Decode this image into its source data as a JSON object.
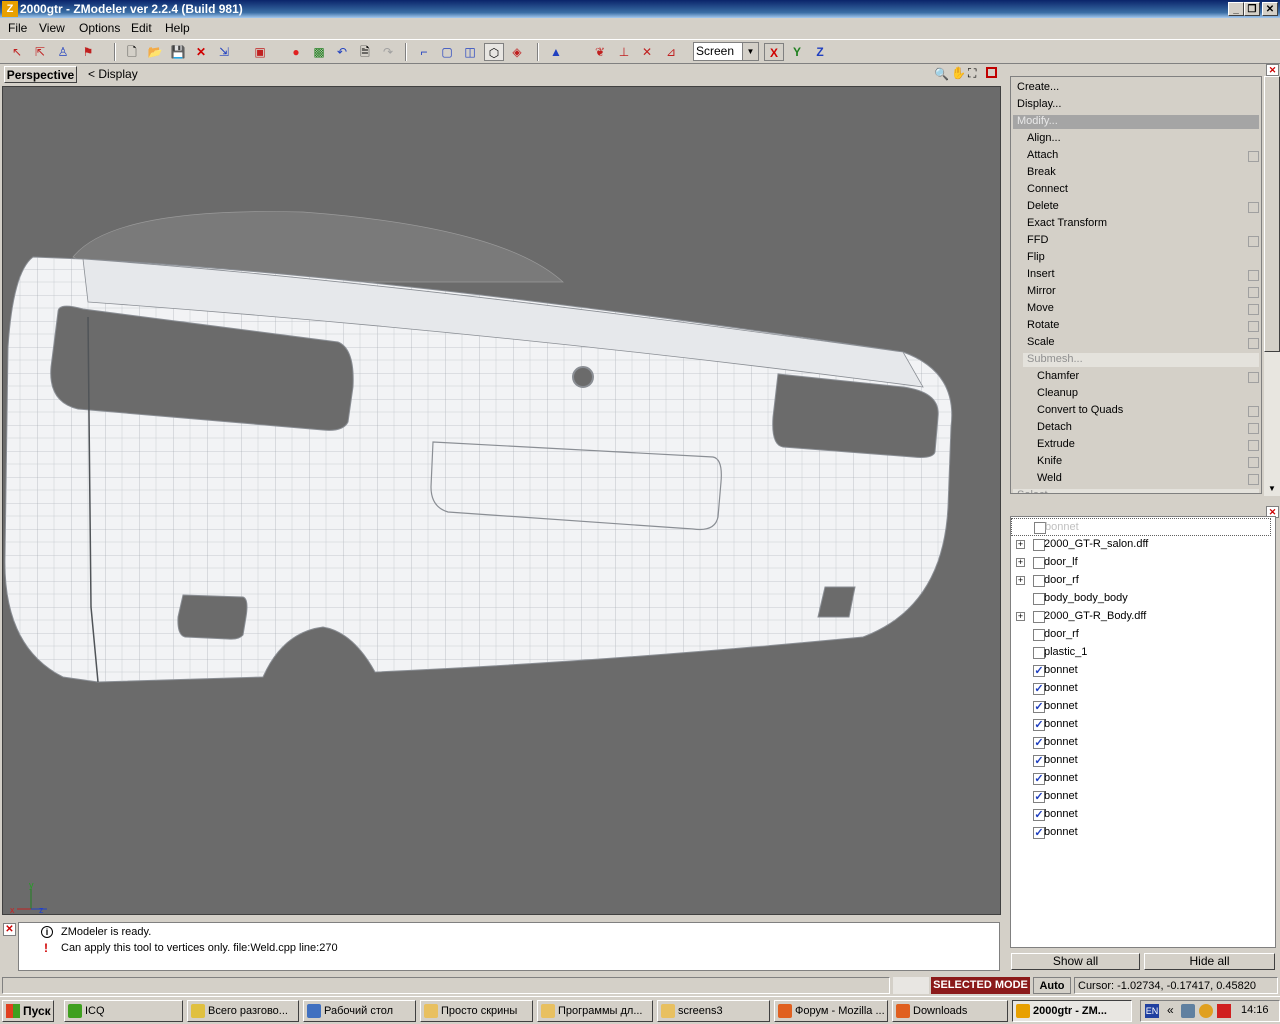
{
  "window": {
    "title": "2000gtr - ZModeler ver 2.2.4 (Build 981)",
    "app_icon": "Z"
  },
  "menubar": {
    "items": [
      "File",
      "View",
      "Options",
      "Edit",
      "Help"
    ]
  },
  "toolbar": {
    "coord_mode": "Screen",
    "axis_x": "X",
    "axis_y": "Y",
    "axis_z": "Z"
  },
  "viewport": {
    "tab": "Perspective",
    "display_link": "<  Display",
    "axis_x": "x",
    "axis_y": "y",
    "axis_z": "z"
  },
  "modify_panel": {
    "items": [
      {
        "label": "Create...",
        "level": 0,
        "checkbox": false,
        "state": "normal"
      },
      {
        "label": "Display...",
        "level": 0,
        "checkbox": false,
        "state": "normal"
      },
      {
        "label": "Modify...",
        "level": 0,
        "checkbox": false,
        "state": "selected"
      },
      {
        "label": "Align...",
        "level": 1,
        "checkbox": false,
        "state": "normal"
      },
      {
        "label": "Attach",
        "level": 1,
        "checkbox": true,
        "state": "normal"
      },
      {
        "label": "Break",
        "level": 1,
        "checkbox": false,
        "state": "normal"
      },
      {
        "label": "Connect",
        "level": 1,
        "checkbox": false,
        "state": "normal"
      },
      {
        "label": "Delete",
        "level": 1,
        "checkbox": true,
        "state": "normal"
      },
      {
        "label": "Exact Transform",
        "level": 1,
        "checkbox": false,
        "state": "normal"
      },
      {
        "label": "FFD",
        "level": 1,
        "checkbox": true,
        "state": "normal"
      },
      {
        "label": "Flip",
        "level": 1,
        "checkbox": false,
        "state": "normal"
      },
      {
        "label": "Insert",
        "level": 1,
        "checkbox": true,
        "state": "normal"
      },
      {
        "label": "Mirror",
        "level": 1,
        "checkbox": true,
        "state": "normal"
      },
      {
        "label": "Move",
        "level": 1,
        "checkbox": true,
        "state": "normal"
      },
      {
        "label": "Rotate",
        "level": 1,
        "checkbox": true,
        "state": "normal"
      },
      {
        "label": "Scale",
        "level": 1,
        "checkbox": true,
        "state": "normal"
      },
      {
        "label": "Submesh...",
        "level": 1,
        "checkbox": false,
        "state": "group"
      },
      {
        "label": "Chamfer",
        "level": 2,
        "checkbox": true,
        "state": "normal"
      },
      {
        "label": "Cleanup",
        "level": 2,
        "checkbox": false,
        "state": "normal"
      },
      {
        "label": "Convert to Quads",
        "level": 2,
        "checkbox": true,
        "state": "normal"
      },
      {
        "label": "Detach",
        "level": 2,
        "checkbox": true,
        "state": "normal"
      },
      {
        "label": "Extrude",
        "level": 2,
        "checkbox": true,
        "state": "normal"
      },
      {
        "label": "Knife",
        "level": 2,
        "checkbox": true,
        "state": "normal"
      },
      {
        "label": "Weld",
        "level": 2,
        "checkbox": true,
        "state": "normal"
      },
      {
        "label": "Select...",
        "level": 0,
        "checkbox": false,
        "state": "group"
      }
    ]
  },
  "objects_panel": {
    "rows": [
      {
        "label": "bonnet",
        "expandable": false,
        "checked": false,
        "highlight": true
      },
      {
        "label": "2000_GT-R_salon.dff",
        "expandable": true,
        "checked": false
      },
      {
        "label": "door_lf",
        "expandable": true,
        "checked": false
      },
      {
        "label": "door_rf",
        "expandable": true,
        "checked": false
      },
      {
        "label": "body_body_body",
        "expandable": false,
        "checked": false
      },
      {
        "label": "2000_GT-R_Body.dff",
        "expandable": true,
        "checked": false
      },
      {
        "label": "door_rf",
        "expandable": false,
        "checked": false
      },
      {
        "label": "plastic_1",
        "expandable": false,
        "checked": false
      },
      {
        "label": "bonnet",
        "expandable": false,
        "checked": true
      },
      {
        "label": "bonnet",
        "expandable": false,
        "checked": true
      },
      {
        "label": "bonnet",
        "expandable": false,
        "checked": true
      },
      {
        "label": "bonnet",
        "expandable": false,
        "checked": true
      },
      {
        "label": "bonnet",
        "expandable": false,
        "checked": true
      },
      {
        "label": "bonnet",
        "expandable": false,
        "checked": true
      },
      {
        "label": "bonnet",
        "expandable": false,
        "checked": true
      },
      {
        "label": "bonnet",
        "expandable": false,
        "checked": true
      },
      {
        "label": "bonnet",
        "expandable": false,
        "checked": true
      },
      {
        "label": "bonnet",
        "expandable": false,
        "checked": true
      }
    ],
    "show_all": "Show all",
    "hide_all": "Hide all"
  },
  "log": {
    "lines": [
      {
        "icon": "info-icon",
        "text": "ZModeler is ready."
      },
      {
        "icon": "error-icon",
        "text": "Can apply this tool to vertices only. file:Weld.cpp line:270"
      }
    ]
  },
  "statusbar": {
    "mode": "SELECTED MODE",
    "auto": "Auto",
    "cursor": "Cursor: -1.02734, -0.17417, 0.45820"
  },
  "taskbar": {
    "start": "Пуск",
    "tasks": [
      {
        "label": "ICQ",
        "icon": "icq-icon"
      },
      {
        "label": "Всего разгово...",
        "icon": "chat-icon"
      },
      {
        "label": "Рабочий стол",
        "icon": "desktop-icon"
      },
      {
        "label": "Просто скрины",
        "icon": "folder-icon"
      },
      {
        "label": "Программы дл...",
        "icon": "folder-icon"
      },
      {
        "label": "screens3",
        "icon": "folder-icon"
      },
      {
        "label": "Форум - Mozilla ...",
        "icon": "firefox-icon"
      },
      {
        "label": "Downloads",
        "icon": "firefox-icon"
      },
      {
        "label": "2000gtr - ZM...",
        "icon": "zmodeler-icon",
        "active": true
      }
    ],
    "lang": "EN",
    "clock": "14:16"
  },
  "colors": {
    "titlebar": "#0a246a",
    "viewport_bg": "#6b6b6b",
    "status_mode_bg": "#8b1a1a",
    "check": "#2040c0"
  }
}
